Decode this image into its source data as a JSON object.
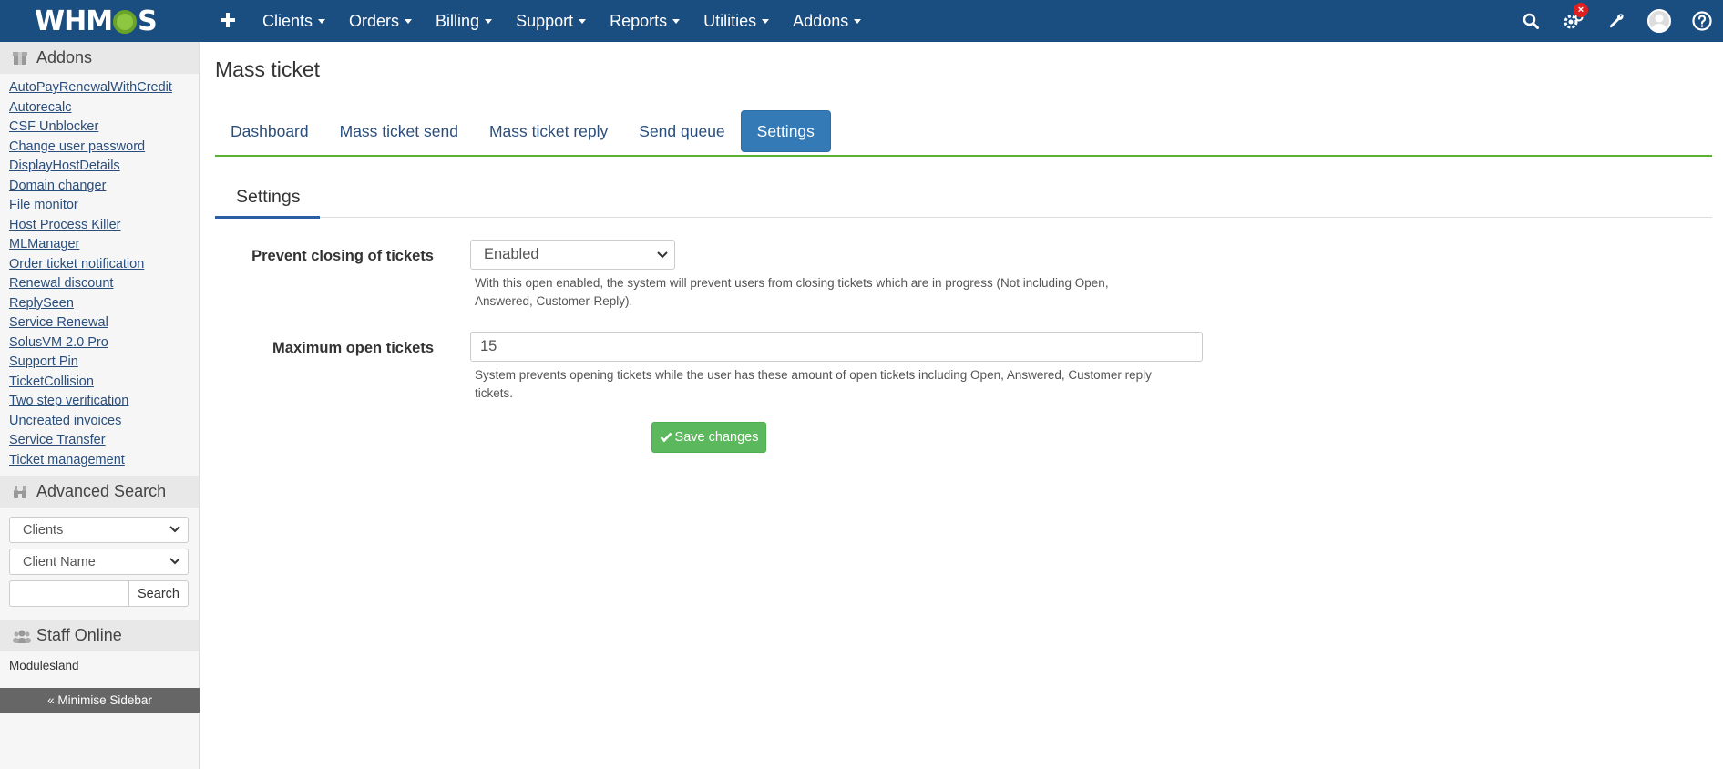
{
  "navbar": {
    "logo_text": [
      "WHM",
      "S"
    ],
    "menu": [
      {
        "label": "Clients"
      },
      {
        "label": "Orders"
      },
      {
        "label": "Billing"
      },
      {
        "label": "Support"
      },
      {
        "label": "Reports"
      },
      {
        "label": "Utilities"
      },
      {
        "label": "Addons"
      }
    ],
    "notification_badge": "×",
    "icons": [
      "plus-icon",
      "search-icon",
      "gears-icon",
      "wrench-icon",
      "avatar",
      "help-icon"
    ]
  },
  "sidebar": {
    "addons": {
      "title": "Addons",
      "links": [
        "AutoPayRenewalWithCredit",
        "Autorecalc",
        "CSF Unblocker",
        "Change user password",
        "DisplayHostDetails",
        "Domain changer",
        "File monitor",
        "Host Process Killer",
        "MLManager",
        "Order ticket notification",
        "Renewal discount",
        "ReplySeen",
        "Service Renewal",
        "SolusVM 2.0 Pro",
        "Support Pin",
        "TicketCollision",
        "Two step verification",
        "Uncreated invoices",
        "Service Transfer",
        "Ticket management"
      ]
    },
    "advanced_search": {
      "title": "Advanced Search",
      "type_select": "Clients",
      "field_select": "Client Name",
      "search_value": "",
      "search_button": "Search"
    },
    "staff_online": {
      "title": "Staff Online",
      "staff": "Modulesland"
    },
    "minimise_label": "« Minimise Sidebar"
  },
  "main": {
    "title": "Mass ticket",
    "tabs": [
      {
        "label": "Dashboard",
        "active": false
      },
      {
        "label": "Mass ticket send",
        "active": false
      },
      {
        "label": "Mass ticket reply",
        "active": false
      },
      {
        "label": "Send queue",
        "active": false
      },
      {
        "label": "Settings",
        "active": true
      }
    ],
    "subtab": "Settings",
    "form": {
      "prevent_closing": {
        "label": "Prevent closing of tickets",
        "value": "Enabled",
        "help_line1": "With this open enabled, the system will prevent users from closing tickets which are in progress (Not including Open,",
        "help_line2": "Answered, Customer-Reply)."
      },
      "max_open": {
        "label": "Maximum open tickets",
        "value": "15",
        "help_line1": "System prevents opening tickets while the user has these amount of open tickets including Open, Answered, Customer reply",
        "help_line2": "tickets."
      },
      "save_label": "Save changes"
    }
  },
  "colors": {
    "navbar": "#1a4d80",
    "tab_active": "#337ab7",
    "tab_underline": "#5cb034",
    "save_button": "#5cb85c",
    "link": "#2a4e7c"
  }
}
